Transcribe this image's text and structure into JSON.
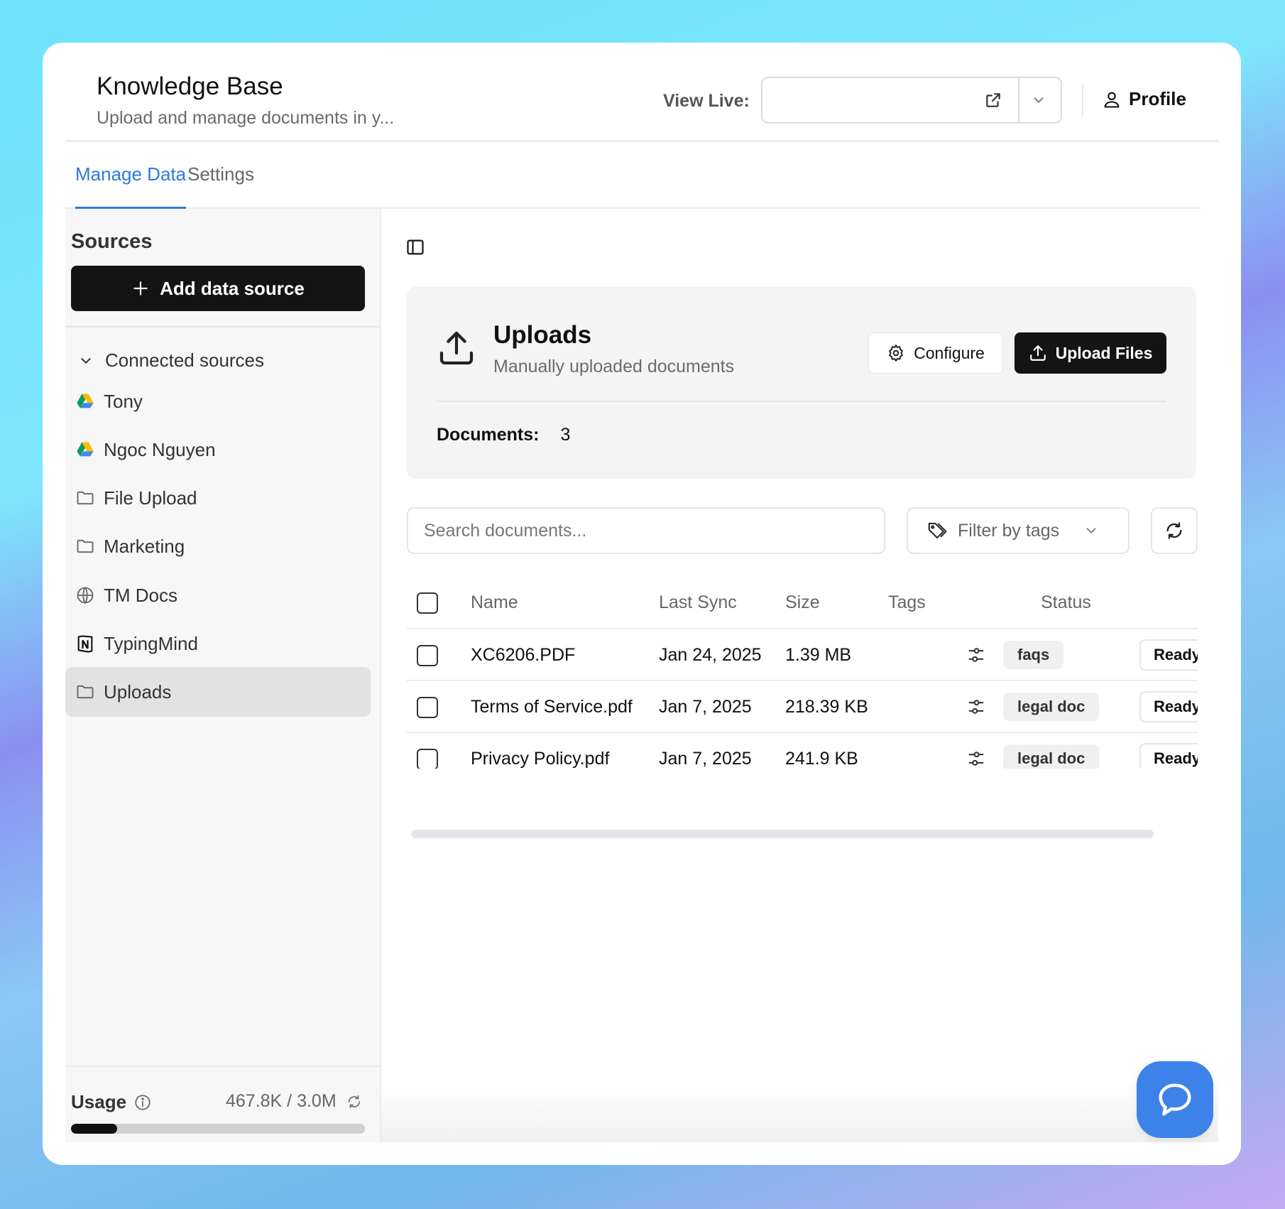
{
  "header": {
    "title": "Knowledge Base",
    "subtitle": "Upload and manage documents in y...",
    "view_live_label": "View Live:",
    "view_live_value": "",
    "profile_label": "Profile"
  },
  "tabs": [
    {
      "label": "Manage Data",
      "active": true
    },
    {
      "label": "Settings",
      "active": false
    }
  ],
  "sidebar": {
    "title": "Sources",
    "add_button": "Add data source",
    "connected_label": "Connected sources",
    "items": [
      {
        "label": "Tony",
        "icon": "google-drive-icon"
      },
      {
        "label": "Ngoc Nguyen",
        "icon": "google-drive-icon"
      },
      {
        "label": "File Upload",
        "icon": "folder-icon"
      },
      {
        "label": "Marketing",
        "icon": "folder-icon"
      },
      {
        "label": "TM Docs",
        "icon": "globe-icon"
      },
      {
        "label": "TypingMind",
        "icon": "notion-icon"
      },
      {
        "label": "Uploads",
        "icon": "folder-icon",
        "active": true
      }
    ],
    "usage": {
      "label": "Usage",
      "value": "467.8K / 3.0M",
      "fraction": 0.156
    }
  },
  "main": {
    "card": {
      "title": "Uploads",
      "subtitle": "Manually uploaded documents",
      "configure_label": "Configure",
      "upload_label": "Upload Files",
      "documents_label": "Documents:",
      "documents_count": "3"
    },
    "search_placeholder": "Search documents...",
    "filter_label": "Filter by tags",
    "table": {
      "columns": [
        "Name",
        "Last Sync",
        "Size",
        "Tags",
        "Status"
      ],
      "rows": [
        {
          "name": "XC6206.PDF",
          "last_sync": "Jan 24, 2025",
          "size": "1.39 MB",
          "tag": "faqs",
          "status": "Ready"
        },
        {
          "name": "Terms of Service.pdf",
          "last_sync": "Jan 7, 2025",
          "size": "218.39 KB",
          "tag": "legal doc",
          "status": "Ready"
        },
        {
          "name": "Privacy Policy.pdf",
          "last_sync": "Jan 7, 2025",
          "size": "241.9 KB",
          "tag": "legal doc",
          "status": "Ready"
        }
      ]
    }
  },
  "colors": {
    "accent": "#2e7bd9",
    "chat_button": "#3d82e8",
    "primary_button": "#141414"
  }
}
